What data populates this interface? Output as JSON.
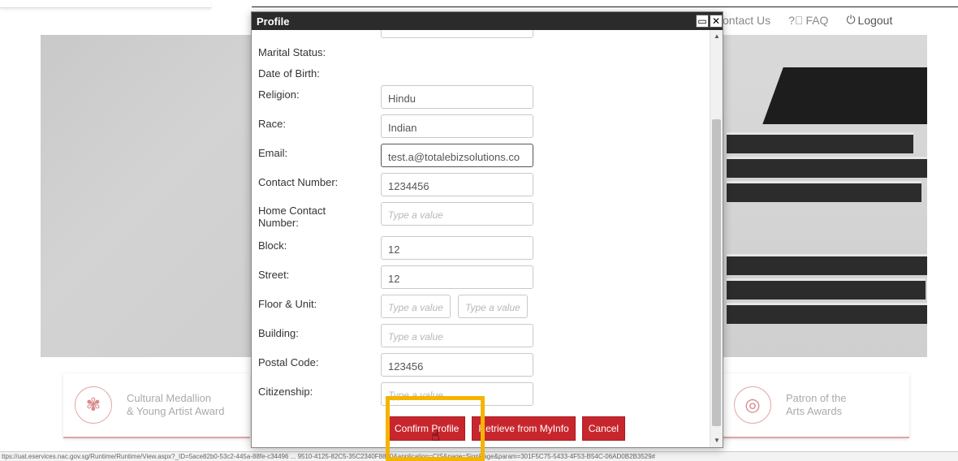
{
  "nav": {
    "contact": "ontact Us",
    "faq_icon": "question-circle-icon",
    "faq": "FAQ",
    "logout_icon": "power-icon",
    "logout": "Logout"
  },
  "cards": {
    "left_text_1": "Cultural Medallion",
    "left_text_2": "& Young Artist Award",
    "right_text_1": "Patron of the",
    "right_text_2": "Arts Awards"
  },
  "statusbar": {
    "url": "ttps://uat.eservices.nac.gov.sg/Runtime/Runtime/View.aspx?_ID=5ace82b0-53c2-445a-88fe-c34496 ... 9510-4125-82C5-35C2340F8870&application=CIS&page=SignPage&param=301F5C75-5433-4F53-B54C-06AD0B2B3529#"
  },
  "dialog": {
    "title": "Profile",
    "maximize_icon": "maximize-icon",
    "close_icon": "close-icon",
    "fields": {
      "marital_status": {
        "label": "Marital Status:"
      },
      "dob": {
        "label": "Date of Birth:"
      },
      "religion": {
        "label": "Religion:",
        "value": "Hindu"
      },
      "race": {
        "label": "Race:",
        "value": "Indian"
      },
      "email": {
        "label": "Email:",
        "value": "test.a@totalebizsolutions.co"
      },
      "contact": {
        "label": "Contact Number:",
        "value": "1234456"
      },
      "home_contact": {
        "label_1": "Home Contact",
        "label_2": "Number:",
        "placeholder": "Type a value"
      },
      "block": {
        "label": "Block:",
        "value": "12"
      },
      "street": {
        "label": "Street:",
        "value": "12"
      },
      "floor_unit": {
        "label": "Floor & Unit:",
        "placeholder_floor": "Type a value",
        "placeholder_unit": "Type a value"
      },
      "building": {
        "label": "Building:",
        "placeholder": "Type a value"
      },
      "postal": {
        "label": "Postal Code:",
        "value": "123456"
      },
      "citizenship": {
        "label": "Citizenship:",
        "placeholder": "Type a value"
      }
    },
    "buttons": {
      "confirm": "Confirm Profile",
      "retrieve": "Retrieve from MyInfo",
      "cancel": "Cancel"
    }
  },
  "colors": {
    "button_red": "#c8262d",
    "header_dark": "#2b2b2b",
    "highlight": "#f5b400"
  }
}
